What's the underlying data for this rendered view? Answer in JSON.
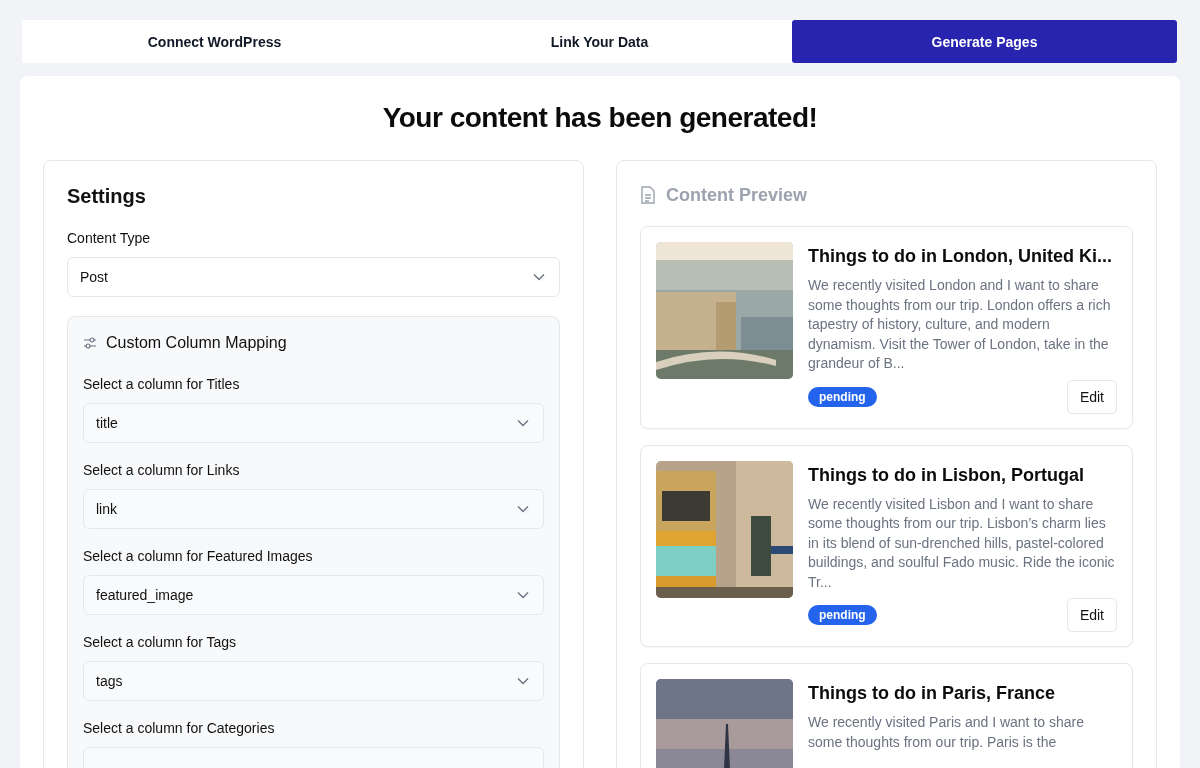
{
  "steps": [
    {
      "label": "Connect WordPress",
      "selected": false
    },
    {
      "label": "Link Your Data",
      "selected": false
    },
    {
      "label": "Generate Pages",
      "selected": true
    }
  ],
  "heading": "Your content has been generated!",
  "settings": {
    "title": "Settings",
    "content_type": {
      "label": "Content Type",
      "value": "Post"
    },
    "mapping": {
      "title": "Custom Column Mapping",
      "fields": [
        {
          "label": "Select a column for Titles",
          "value": "title"
        },
        {
          "label": "Select a column for Links",
          "value": "link"
        },
        {
          "label": "Select a column for Featured Images",
          "value": "featured_image"
        },
        {
          "label": "Select a column for Tags",
          "value": "tags"
        },
        {
          "label": "Select a column for Categories"
        }
      ]
    }
  },
  "preview": {
    "title": "Content Preview",
    "items": [
      {
        "title": "Things to do in London, United Ki...",
        "description": "We recently visited London and I want to share some thoughts from our trip. London offers a rich tapestry of history, culture, and modern dynamism. Visit the Tower of London, take in the grandeur of B...",
        "status": "pending",
        "action": "Edit"
      },
      {
        "title": "Things to do in Lisbon, Portugal",
        "description": "We recently visited Lisbon and I want to share some thoughts from our trip. Lisbon’s charm lies in its blend of sun-drenched hills, pastel-colored buildings, and soulful Fado music. Ride the iconic Tr...",
        "status": "pending",
        "action": "Edit"
      },
      {
        "title": "Things to do in Paris, France",
        "description": "We recently visited Paris and I want to share some thoughts from our trip. Paris is the"
      }
    ]
  }
}
